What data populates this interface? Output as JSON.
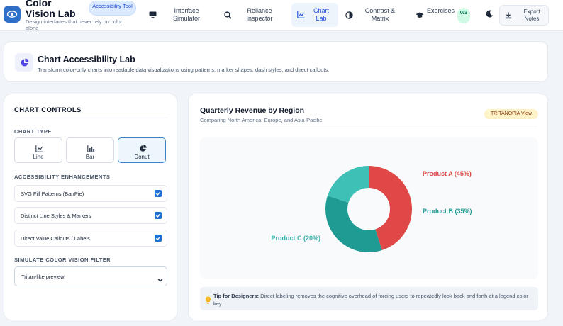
{
  "colors": {
    "accent": "#2f6fc9",
    "product_a": "#e04848",
    "product_b": "#1f9b94",
    "product_c": "#3fc0b6"
  },
  "brand": {
    "title": "Color Vision Lab",
    "subtitle": "Design interfaces that never rely on color alone",
    "badge": "Accessibility Tool",
    "icon": "eye-icon"
  },
  "nav": {
    "items": [
      {
        "label": "Interface Simulator",
        "icon": "monitor-icon"
      },
      {
        "label": "Reliance Inspector",
        "icon": "search-icon"
      },
      {
        "label": "Chart Lab",
        "icon": "line-chart-icon",
        "active": true
      },
      {
        "label": "Contrast & Matrix",
        "icon": "contrast-icon"
      },
      {
        "label": "Exercises",
        "icon": "graduation-cap-icon",
        "count": "0/3"
      }
    ],
    "theme_icon": "moon-icon",
    "export_label": "Export Notes",
    "export_icon": "download-icon"
  },
  "lab": {
    "title": "Chart Accessibility Lab",
    "description": "Transform color-only charts into readable data visualizations using patterns, marker shapes, dash styles, and direct callouts.",
    "icon": "pie-chart-icon"
  },
  "controls": {
    "heading": "CHART CONTROLS",
    "chart_type_label": "CHART TYPE",
    "types": [
      {
        "label": "Line",
        "icon": "line-chart-icon"
      },
      {
        "label": "Bar",
        "icon": "bar-chart-icon"
      },
      {
        "label": "Donut",
        "icon": "pie-chart-icon",
        "active": true
      }
    ],
    "enhancements_label": "ACCESSIBILITY ENHANCEMENTS",
    "toggles": [
      {
        "label": "SVG Fill Patterns (Bar/Pie)",
        "checked": true
      },
      {
        "label": "Distinct Line Styles & Markers",
        "checked": true
      },
      {
        "label": "Direct Value Callouts / Labels",
        "checked": true
      }
    ],
    "filter_label": "SIMULATE COLOR VISION FILTER",
    "filter_value": "Tritan-like preview"
  },
  "chart_panel": {
    "title": "Quarterly Revenue by Region",
    "subtitle": "Comparing North America, Europe, and Asia-Pacific",
    "badge": "TRITANOPIA View",
    "tip_strong": "Tip for Designers:",
    "tip_text": "Direct labeling removes the cognitive overhead of forcing users to repeatedly look back and forth at a legend color key.",
    "tip_icon": "lightbulb-icon"
  },
  "chart_data": {
    "type": "pie",
    "donut": true,
    "categories": [
      "Product A",
      "Product B",
      "Product C"
    ],
    "values": [
      45,
      35,
      20
    ],
    "labels": [
      "Product A (45%)",
      "Product B (35%)",
      "Product C (20%)"
    ],
    "colors": [
      "#e04848",
      "#1f9b94",
      "#3fc0b6"
    ],
    "title": "",
    "legend": "direct-labels"
  }
}
